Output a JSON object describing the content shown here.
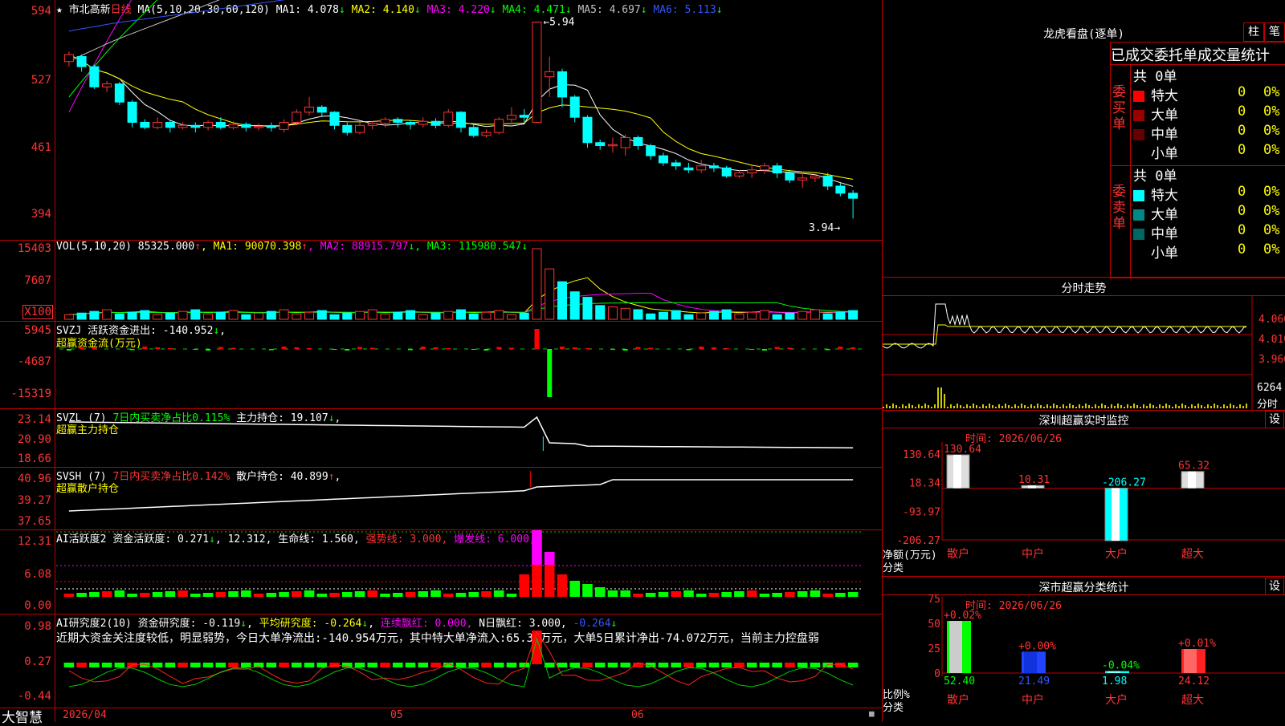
{
  "main": {
    "security_name": "市北高新",
    "period": "日线",
    "ma_label": "MA(5,10,20,30,60,120)",
    "ma": [
      {
        "name": "MA1",
        "value": "4.078",
        "dir": "↓",
        "color": "#ffffff"
      },
      {
        "name": "MA2",
        "value": "4.140",
        "dir": "↓",
        "color": "#ffff00"
      },
      {
        "name": "MA3",
        "value": "4.220",
        "dir": "↓",
        "color": "#ff00ff"
      },
      {
        "name": "MA4",
        "value": "4.471",
        "dir": "↓",
        "color": "#00ff00"
      },
      {
        "name": "MA5",
        "value": "4.697",
        "dir": "↓",
        "color": "#c0c0c0"
      },
      {
        "name": "MA6",
        "value": "5.113",
        "dir": "↓",
        "color": "#3355ff"
      }
    ],
    "y_ticks": [
      "594",
      "527",
      "461",
      "394"
    ],
    "high_label": "5.94",
    "low_label": "3.94",
    "star": "★"
  },
  "vol": {
    "label": "VOL(5,10,20)",
    "value": "85325.000",
    "value_dir": "↑",
    "ma": [
      {
        "name": "MA1",
        "value": "90070.398",
        "dir": "↑",
        "color": "#ffff00"
      },
      {
        "name": "MA2",
        "value": "88915.797",
        "dir": "↓",
        "color": "#ff00ff"
      },
      {
        "name": "MA3",
        "value": "115980.547",
        "dir": "↓",
        "color": "#00ff00"
      }
    ],
    "y_ticks": [
      "15403",
      "7607"
    ],
    "unit": "X100"
  },
  "svzj": {
    "label": "SVZJ",
    "text": "活跃资金进出:",
    "value": "-140.952",
    "dir": "↓",
    "subtitle": "超赢资金流(万元)",
    "y_ticks": [
      "5945",
      "-4687",
      "-15319"
    ]
  },
  "svzl": {
    "label": "SVZL (7)",
    "ratio": "7日内买卖净占比0.115%",
    "text": "主力持仓:",
    "value": "19.107",
    "dir": "↓",
    "subtitle": "超赢主力持仓",
    "y_ticks": [
      "23.14",
      "20.90",
      "18.66"
    ]
  },
  "svsh": {
    "label": "SVSH (7)",
    "ratio": "7日内买卖净占比0.142%",
    "text": "散户持仓:",
    "value": "40.899",
    "dir": "↑",
    "subtitle": "超赢散户持仓",
    "y_ticks": [
      "40.96",
      "39.27",
      "37.65"
    ]
  },
  "ai_active": {
    "label": "AI活跃度2",
    "t1": "资金活跃度:",
    "v1": "0.271",
    "d1": "↓",
    "v2": "12.312",
    "t3": "生命线:",
    "v3": "1.560",
    "t4": "强势线:",
    "v4": "3.000",
    "t5": "爆发线:",
    "v5": "6.000",
    "y_ticks": [
      "12.31",
      "6.08",
      "0.00"
    ]
  },
  "ai_research": {
    "label": "AI研究度2(10)",
    "t1": "资金研究度:",
    "v1": "-0.119",
    "d1": "↓",
    "t2": "平均研究度:",
    "v2": "-0.264",
    "d2": "↓",
    "t3": "连续飘红:",
    "v3": "0.000",
    "t4": "N日飘红:",
    "v4": "3.000",
    "v5": "-0.264",
    "d5": "↓",
    "comment": "近期大资金关注度较低，明显弱势，今日大单净流出:-140.954万元，其中特大单净流入:65.32万元，大单5日累计净出-74.072万元，当前主力控盘弱",
    "y_ticks": [
      "0.98",
      "0.27",
      "-0.44"
    ]
  },
  "bottom": {
    "brand": "大智慧",
    "dates": [
      "2026/04",
      "05",
      "06"
    ]
  },
  "right": {
    "lhb_title": "龙虎看盘(逐单)",
    "tab1": "柱",
    "tab2": "笔",
    "stats_title": "已成交委托单成交量统计",
    "buy_label": "委买单",
    "sell_label": "委卖单",
    "buy_total": "共 0单",
    "sell_total": "共 0单",
    "buy_rows": [
      {
        "name": "特大",
        "count": "0",
        "pct": "0%",
        "color": "#ff0000"
      },
      {
        "name": "大单",
        "count": "0",
        "pct": "0%",
        "color": "#990000"
      },
      {
        "name": "中单",
        "count": "0",
        "pct": "0%",
        "color": "#660000"
      },
      {
        "name": "小单",
        "count": "0",
        "pct": "0%",
        "color": "#000000"
      }
    ],
    "sell_rows": [
      {
        "name": "特大",
        "count": "0",
        "pct": "0%",
        "color": "#00ffff"
      },
      {
        "name": "大单",
        "count": "0",
        "pct": "0%",
        "color": "#008888"
      },
      {
        "name": "中单",
        "count": "0",
        "pct": "0%",
        "color": "#006666"
      },
      {
        "name": "小单",
        "count": "0",
        "pct": "0%",
        "color": "#000000"
      }
    ],
    "intraday_title": "分时走势",
    "intraday_ticks": [
      "4.060",
      "4.010",
      "3.960"
    ],
    "intraday_vol": "6264",
    "intraday_unit": "分时",
    "monitor_title": "深圳超赢实时监控",
    "monitor_setting": "设",
    "monitor_time": "时间: 2026/06/26",
    "monitor_ticks": [
      "130.64",
      "18.34",
      "-93.97",
      "-206.27"
    ],
    "monitor_axis_label": "净额(万元)",
    "monitor_axis_label2": "分类",
    "categories": [
      "散户",
      "中户",
      "大户",
      "超大"
    ],
    "monitor_values": [
      {
        "label": "130.64",
        "value": 130.64
      },
      {
        "label": "10.31",
        "value": 10.31
      },
      {
        "label": "-206.27",
        "value": -206.27
      },
      {
        "label": "65.32",
        "value": 65.32
      }
    ],
    "class_title": "深市超赢分类统计",
    "class_setting": "设",
    "class_time": "时间: 2026/06/26",
    "class_ticks": [
      "75",
      "50",
      "25",
      "0"
    ],
    "class_axis_label": "比例%",
    "class_axis_label2": "分类",
    "class_changes": [
      "+0.02%",
      "+0.00%",
      "-0.04%",
      "+0.01%"
    ],
    "class_values": [
      "52.40",
      "21.49",
      "1.98",
      "24.12"
    ]
  },
  "chart_data": {
    "type": "candlestick",
    "note_series": "daily candles",
    "price_range": [
      3.94,
      5.94
    ],
    "candles": [
      [
        5.55,
        5.62,
        5.5,
        5.65
      ],
      [
        5.6,
        5.5,
        5.45,
        5.62
      ],
      [
        5.5,
        5.3,
        5.28,
        5.52
      ],
      [
        5.3,
        5.33,
        5.25,
        5.36
      ],
      [
        5.33,
        5.15,
        5.12,
        5.35
      ],
      [
        5.15,
        4.95,
        4.9,
        5.17
      ],
      [
        4.95,
        4.9,
        4.88,
        4.98
      ],
      [
        4.9,
        4.95,
        4.88,
        5.0
      ],
      [
        4.95,
        4.9,
        4.85,
        4.97
      ],
      [
        4.9,
        4.92,
        4.88,
        4.95
      ],
      [
        4.92,
        4.9,
        4.85,
        4.95
      ],
      [
        4.9,
        4.95,
        4.87,
        4.97
      ],
      [
        4.95,
        4.9,
        4.88,
        5.0
      ],
      [
        4.9,
        4.93,
        4.88,
        4.96
      ],
      [
        4.93,
        4.9,
        4.86,
        4.95
      ],
      [
        4.9,
        4.91,
        4.87,
        4.94
      ],
      [
        4.91,
        4.9,
        4.86,
        4.95
      ],
      [
        4.88,
        4.95,
        4.85,
        4.98
      ],
      [
        4.95,
        5.05,
        4.92,
        5.08
      ],
      [
        5.05,
        5.1,
        5.02,
        5.2
      ],
      [
        5.1,
        5.05,
        5.0,
        5.12
      ],
      [
        5.05,
        4.92,
        4.88,
        5.06
      ],
      [
        4.92,
        4.85,
        4.82,
        4.95
      ],
      [
        4.85,
        4.92,
        4.83,
        4.95
      ],
      [
        4.92,
        4.94,
        4.88,
        4.96
      ],
      [
        4.94,
        4.98,
        4.9,
        5.0
      ],
      [
        4.98,
        4.95,
        4.9,
        5.0
      ],
      [
        4.95,
        4.93,
        4.88,
        4.97
      ],
      [
        4.93,
        4.96,
        4.9,
        5.0
      ],
      [
        4.96,
        4.92,
        4.89,
        4.99
      ],
      [
        4.92,
        5.05,
        4.9,
        5.08
      ],
      [
        5.05,
        4.9,
        4.85,
        5.06
      ],
      [
        4.9,
        4.82,
        4.8,
        4.93
      ],
      [
        4.82,
        4.85,
        4.8,
        4.88
      ],
      [
        4.85,
        4.98,
        4.83,
        5.0
      ],
      [
        4.98,
        5.02,
        4.95,
        5.1
      ],
      [
        5.02,
        5.0,
        4.95,
        5.08
      ],
      [
        4.95,
        5.94,
        4.95,
        5.94
      ],
      [
        5.4,
        5.45,
        5.2,
        5.6
      ],
      [
        5.45,
        5.2,
        5.1,
        5.48
      ],
      [
        5.2,
        5.0,
        4.95,
        5.22
      ],
      [
        5.0,
        4.75,
        4.7,
        5.02
      ],
      [
        4.75,
        4.72,
        4.68,
        4.78
      ],
      [
        4.72,
        4.73,
        4.65,
        4.8
      ],
      [
        4.7,
        4.8,
        4.62,
        4.83
      ],
      [
        4.8,
        4.72,
        4.68,
        4.82
      ],
      [
        4.72,
        4.62,
        4.58,
        4.74
      ],
      [
        4.62,
        4.55,
        4.52,
        4.65
      ],
      [
        4.55,
        4.52,
        4.48,
        4.58
      ],
      [
        4.5,
        4.48,
        4.45,
        4.55
      ],
      [
        4.48,
        4.52,
        4.45,
        4.58
      ],
      [
        4.52,
        4.5,
        4.46,
        4.55
      ],
      [
        4.5,
        4.42,
        4.4,
        4.52
      ],
      [
        4.42,
        4.45,
        4.4,
        4.48
      ],
      [
        4.45,
        4.48,
        4.4,
        4.52
      ],
      [
        4.48,
        4.52,
        4.44,
        4.55
      ],
      [
        4.52,
        4.45,
        4.4,
        4.55
      ],
      [
        4.45,
        4.38,
        4.35,
        4.48
      ],
      [
        4.38,
        4.4,
        4.3,
        4.45
      ],
      [
        4.4,
        4.42,
        4.36,
        4.44
      ],
      [
        4.42,
        4.32,
        4.28,
        4.45
      ],
      [
        4.32,
        4.25,
        4.22,
        4.35
      ],
      [
        4.25,
        4.2,
        4.0,
        4.28
      ]
    ]
  }
}
